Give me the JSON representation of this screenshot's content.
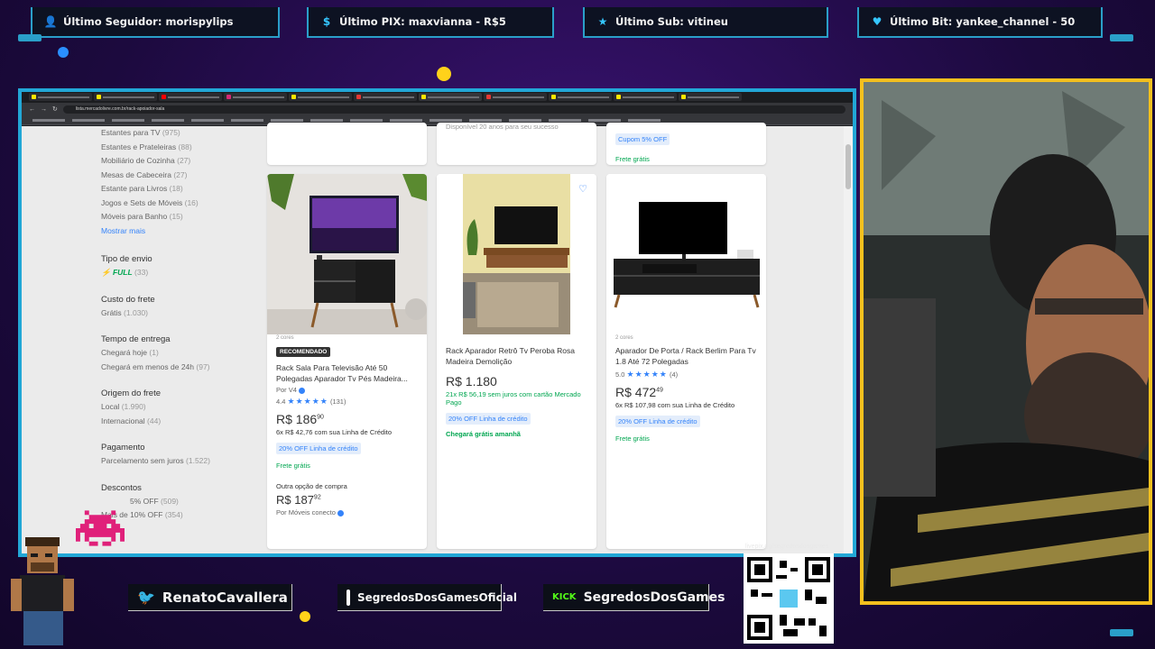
{
  "alerts": {
    "follower": "Último Seguidor: morispylips",
    "pix": "Último PIX: maxvianna - R$5",
    "sub": "Último Sub: vitineu",
    "bit": "Último Bit: yankee_channel - 50"
  },
  "browser": {
    "url": "lista.mercadolivre.com.br/rack-apoiador-sala"
  },
  "filters": {
    "categories": [
      {
        "label": "Estantes para TV",
        "count": "(975)"
      },
      {
        "label": "Estantes e Prateleiras",
        "count": "(88)"
      },
      {
        "label": "Mobiliário de Cozinha",
        "count": "(27)"
      },
      {
        "label": "Mesas de Cabeceira",
        "count": "(27)"
      },
      {
        "label": "Estante para Livros",
        "count": "(18)"
      },
      {
        "label": "Jogos e Sets de Móveis",
        "count": "(16)"
      },
      {
        "label": "Móveis para Banho",
        "count": "(15)"
      }
    ],
    "show_more": "Mostrar mais",
    "shipping_type_title": "Tipo de envio",
    "full_label": "FULL",
    "full_count": "(33)",
    "shipping_cost_title": "Custo do frete",
    "free_label": "Grátis",
    "free_count": "(1.030)",
    "delivery_title": "Tempo de entrega",
    "delivery_today": "Chegará hoje",
    "delivery_today_count": "(1)",
    "delivery_24h": "Chegará em menos de 24h",
    "delivery_24h_count": "(97)",
    "origin_title": "Origem do frete",
    "origin_local": "Local",
    "origin_local_count": "(1.990)",
    "origin_intl": "Internacional",
    "origin_intl_count": "(44)",
    "payment_title": "Pagamento",
    "payment_installments": "Parcelamento sem juros",
    "payment_count": "(1.522)",
    "discount_title": "Descontos",
    "discount_5": "5% OFF",
    "discount_5_count": "(509)",
    "discount_10": "Mais de 10% OFF",
    "discount_10_count": "(354)"
  },
  "top_cards": {
    "card2_text": "Disponível 20 anos para seu sucesso",
    "card3_coupon": "Cupom 5% OFF",
    "card3_free": "Frete grátis"
  },
  "products": [
    {
      "more": "2 cores",
      "badge": "RECOMENDADO",
      "title": "Rack Sala Para Televisão Até 50 Polegadas Aparador Tv Pés Madeira...",
      "seller": "Por V4",
      "rating": "4.4",
      "stars": "★★★★★",
      "reviews": "(131)",
      "price": "R$ 186",
      "cents": "90",
      "installments": "6x R$ 42,76 com sua Linha de Crédito",
      "chip": "20% OFF Linha de crédito",
      "free": "Frete grátis",
      "other_label": "Outra opção de compra",
      "other_price": "R$ 187",
      "other_cents": "92",
      "other_seller": "Por Móveis conecto"
    },
    {
      "title": "Rack Aparador Retrô Tv Peroba Rosa Madeira Demolição",
      "price": "R$ 1.180",
      "installments": "21x R$ 56,19 sem juros com cartão Mercado Pago",
      "chip": "20% OFF Linha de crédito",
      "delivery": "Chegará grátis amanhã"
    },
    {
      "more": "2 cores",
      "title": "Aparador De Porta / Rack Berlim Para Tv 1.8 Até 72 Polegadas",
      "rating": "5.0",
      "stars": "★★★★★",
      "reviews": "(4)",
      "price": "R$ 472",
      "cents": "49",
      "installments": "6x R$ 107,98 com sua Linha de Crédito",
      "chip": "20% OFF Linha de crédito",
      "free": "Frete grátis"
    }
  ],
  "socials": {
    "twitter": "RenatoCavallera",
    "instagram": "SegredosDosGamesOficial",
    "kick_badge": "KICK",
    "kick": "SegredosDosGames"
  },
  "qr_label": "livepix.gg/segredosdosgames",
  "colors": {
    "frame": "#22a7d6",
    "cam_border": "#f4c01e",
    "ml_blue": "#3483fa",
    "ml_green": "#00a650"
  }
}
